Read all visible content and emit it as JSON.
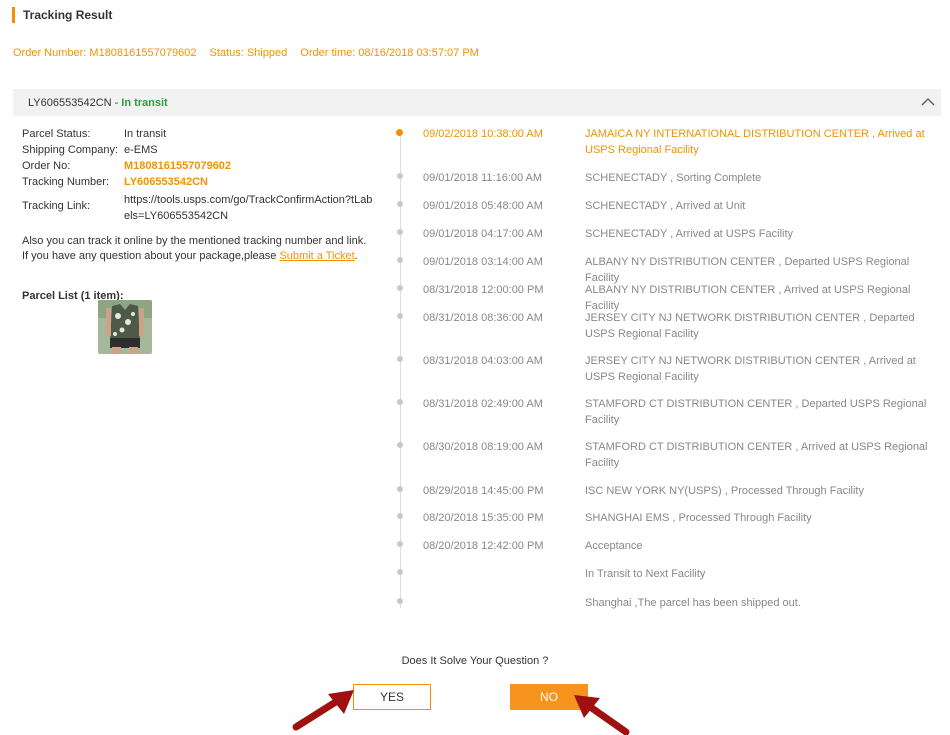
{
  "header": {
    "title": "Tracking Result"
  },
  "order": {
    "number": "Order Number: M1808161557079602",
    "status": "Status: Shipped",
    "time": "Order time: 08/16/2018 03:57:07 PM"
  },
  "parcel": {
    "tracking_id": "LY606553542CN",
    "separator": "-",
    "status": "In transit"
  },
  "info": {
    "parcel_status_label": "Parcel Status:",
    "parcel_status_value": "In transit",
    "shipping_company_label": "Shipping Company:",
    "shipping_company_value": "e-EMS",
    "order_no_label": "Order No:",
    "order_no_value": "M1808161557079602",
    "tracking_number_label": "Tracking Number:",
    "tracking_number_value": "LY606553542CN",
    "tracking_link_label": "Tracking Link:",
    "tracking_link_value": "https://tools.usps.com/go/TrackConfirmAction?tLabels=LY606553542CN",
    "note_line1": "Also you can track it online by the mentioned tracking number and link.",
    "note_line2": "If you have any question about your package,please",
    "submit_ticket": "Submit a Ticket",
    "note_end": ".",
    "parcel_list_title": "Parcel List (1 item):"
  },
  "timeline": [
    {
      "time": "09/02/2018 10:38:00 AM",
      "desc": "JAMAICA NY INTERNATIONAL DISTRIBUTION CENTER , Arrived at USPS Regional Facility"
    },
    {
      "time": "09/01/2018 11:16:00 AM",
      "desc": "SCHENECTADY , Sorting Complete"
    },
    {
      "time": "09/01/2018 05:48:00 AM",
      "desc": "SCHENECTADY , Arrived at Unit"
    },
    {
      "time": "09/01/2018 04:17:00 AM",
      "desc": "SCHENECTADY , Arrived at USPS Facility"
    },
    {
      "time": "09/01/2018 03:14:00 AM",
      "desc": "ALBANY NY DISTRIBUTION CENTER , Departed USPS Regional Facility"
    },
    {
      "time": "08/31/2018 12:00:00 PM",
      "desc": "ALBANY NY DISTRIBUTION CENTER , Arrived at USPS Regional Facility"
    },
    {
      "time": "08/31/2018 08:36:00 AM",
      "desc": "JERSEY CITY NJ NETWORK DISTRIBUTION CENTER , Departed USPS Regional Facility"
    },
    {
      "time": "08/31/2018 04:03:00 AM",
      "desc": "JERSEY CITY NJ NETWORK DISTRIBUTION CENTER , Arrived at USPS Regional Facility"
    },
    {
      "time": "08/31/2018 02:49:00 AM",
      "desc": "STAMFORD CT DISTRIBUTION CENTER , Departed USPS Regional Facility"
    },
    {
      "time": "08/30/2018 08:19:00 AM",
      "desc": "STAMFORD CT DISTRIBUTION CENTER , Arrived at USPS Regional Facility"
    },
    {
      "time": "08/29/2018 14:45:00 PM",
      "desc": "ISC NEW YORK NY(USPS) , Processed Through Facility"
    },
    {
      "time": "08/20/2018 15:35:00 PM",
      "desc": "SHANGHAI EMS , Processed Through Facility"
    },
    {
      "time": "08/20/2018 12:42:00 PM",
      "desc": "Acceptance"
    },
    {
      "time": "",
      "desc": "In Transit to Next Facility"
    },
    {
      "time": "",
      "desc": "Shanghai ,The parcel has been shipped out."
    }
  ],
  "feedback": {
    "question": "Does It Solve Your Question ?",
    "yes_label": "YES",
    "no_label": "NO"
  },
  "colors": {
    "accent": "#f39200",
    "status_green": "#2e9e3e",
    "arrow_red": "#a01010"
  }
}
